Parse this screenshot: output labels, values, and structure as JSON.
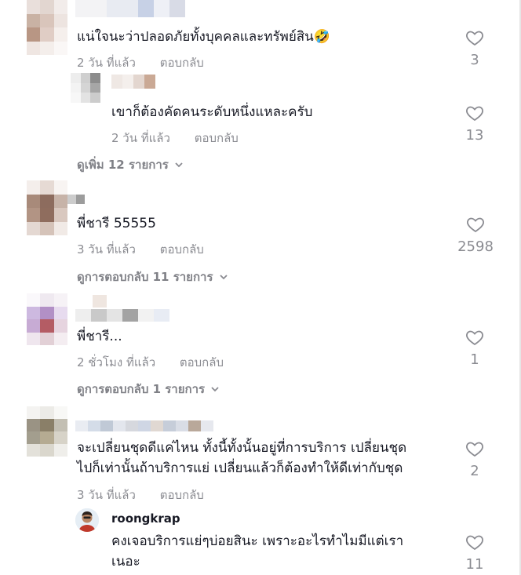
{
  "colors": {
    "text": "#161823",
    "muted": "rgba(22,24,35,0.5)"
  },
  "comments": [
    {
      "text": "แน่ใจนะว่าปลอดภัยทั้งบุคคลและทรัพย์สิน🤣",
      "time": "2 วัน ที่แล้ว",
      "reply_label": "ตอบกลับ",
      "likes": "3",
      "replies": [
        {
          "text": "เขาก็ต้องคัดคนระดับหนึ่งแหละครับ",
          "time": "2 วัน ที่แล้ว",
          "reply_label": "ตอบกลับ",
          "likes": "13"
        }
      ],
      "more_label": "ดูเพิ่ม 12 รายการ"
    },
    {
      "text": "พี่ชารี 55555",
      "time": "3 วัน ที่แล้ว",
      "reply_label": "ตอบกลับ",
      "likes": "2598",
      "more_label": "ดูการตอบกลับ 11 รายการ"
    },
    {
      "text": "พี่ชารี...",
      "time": "2 ชั่วโมง ที่แล้ว",
      "reply_label": "ตอบกลับ",
      "likes": "1",
      "more_label": "ดูการตอบกลับ 1 รายการ"
    },
    {
      "text_line1": "จะเปลี่ยนชุดดีแค่ไหน ทั้งนี้ทั้งนั้นอยู่ที่การบริการ เปลี่ยนชุด",
      "text_line2": "ไปก็เท่านั้นถ้าบริการแย่ เปลี่ยนแล้วก็ต้องทำให้ดีเท่ากับชุด",
      "time": "3 วัน ที่แล้ว",
      "reply_label": "ตอบกลับ",
      "likes": "2",
      "replies": [
        {
          "username": "roongkrap",
          "text_line1": "คงเจอบริการแย่ๆบ่อยสินะ เพราะอะไรทำไมมีแต่เรา",
          "text_line2": "เนอะ",
          "likes": "11"
        }
      ]
    }
  ],
  "icons": {
    "like": "heart-outline-icon",
    "expand": "chevron-down-icon"
  }
}
